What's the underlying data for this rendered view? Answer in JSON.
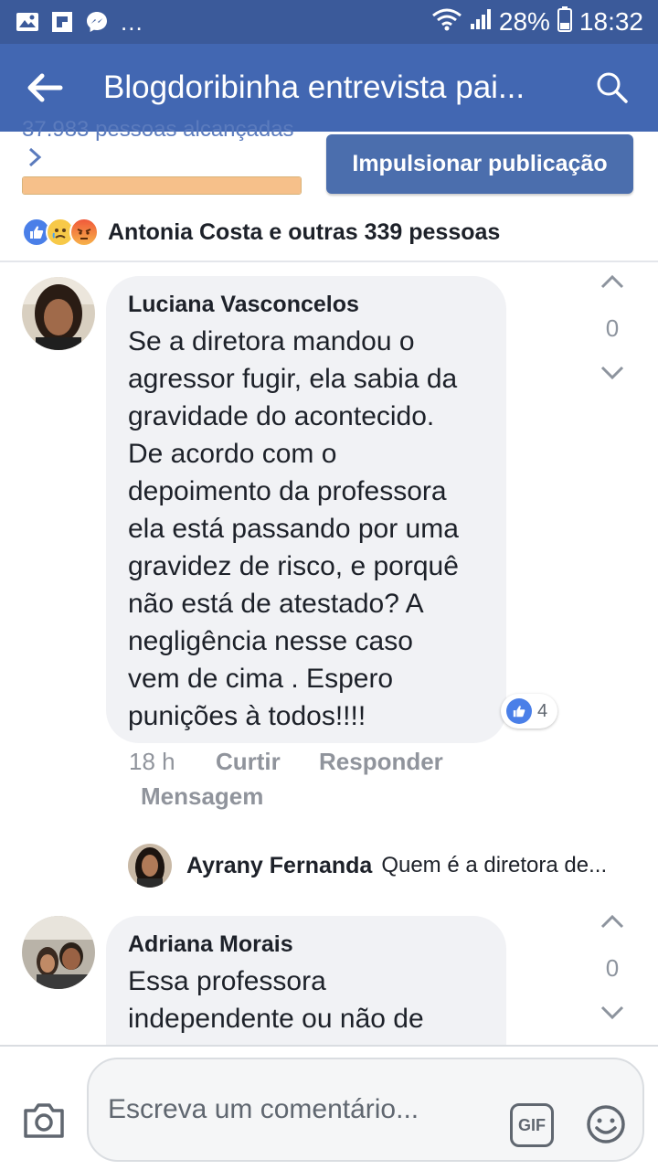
{
  "status_bar": {
    "battery": "28%",
    "time": "18:32",
    "overflow": "...",
    "icons": [
      "gallery-icon",
      "flipboard-icon",
      "messenger-icon",
      "wifi-icon",
      "signal-icon",
      "battery-icon"
    ]
  },
  "app_bar": {
    "title": "Blogdoribinha entrevista pai...",
    "icons": [
      "back-arrow-icon",
      "search-icon"
    ]
  },
  "stats": {
    "reach_text": "37.983 pessoas alcançadas",
    "boost_button": "Impulsionar publicação",
    "progress": 1.0,
    "reactions_summary": "Antonia Costa e outras 339 pessoas",
    "reaction_icons": [
      "like-icon",
      "sad-icon",
      "angry-icon"
    ]
  },
  "colors": {
    "statusbar": "#3b5a9a",
    "appbar": "#4267b2",
    "boost": "#4b6ead",
    "progress_fill": "#f6c08a",
    "like_blue": "#4a7fe8"
  },
  "comments": [
    {
      "author": "Luciana Vasconcelos",
      "lines": [
        "Se a diretora mandou o",
        "agressor fugir, ela sabia da",
        "gravidade do acontecido.",
        "De acordo com o",
        "depoimento da professora",
        "ela está passando por uma",
        "gravidez de risco, e porquê",
        "não está de atestado? A",
        "negligência nesse caso",
        "vem de cima . Espero",
        "punições à todos!!!!"
      ],
      "vote_count": "0",
      "like_count": "4",
      "time": "18 h",
      "actions": [
        "Curtir",
        "Responder",
        "Mensagem"
      ],
      "reply_preview": {
        "author": "Ayrany Fernanda",
        "text": "Quem é a diretora de..."
      }
    },
    {
      "author": "Adriana Morais",
      "lines": [
        "Essa professora",
        "independente ou não de"
      ],
      "vote_count": "0"
    }
  ],
  "composer": {
    "placeholder": "Escreva um comentário...",
    "gif_label": "GIF",
    "icons": [
      "camera-icon",
      "emoji-icon"
    ]
  }
}
